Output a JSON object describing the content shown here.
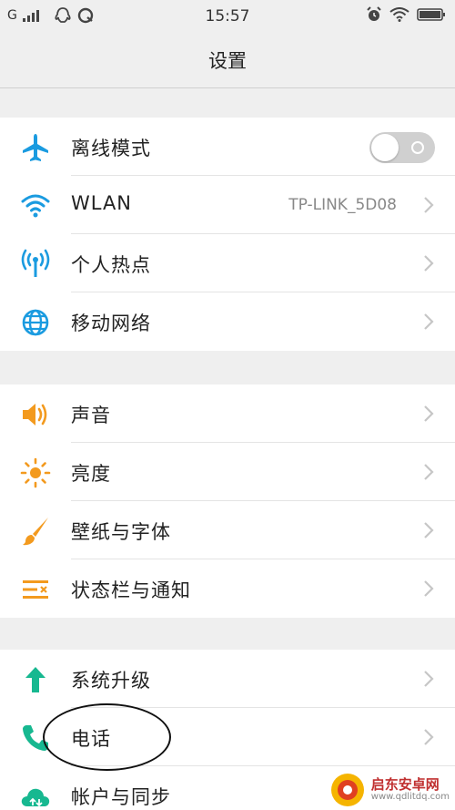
{
  "status_bar": {
    "carrier": "G",
    "time": "15:57"
  },
  "header": {
    "title": "设置"
  },
  "groups": [
    {
      "items": [
        {
          "label": "离线模式",
          "icon": "airplane-icon",
          "toggle_on": false
        },
        {
          "label": "WLAN",
          "icon": "wifi-icon",
          "value": "TP-LINK_5D08"
        },
        {
          "label": "个人热点",
          "icon": "hotspot-icon"
        },
        {
          "label": "移动网络",
          "icon": "globe-icon"
        }
      ]
    },
    {
      "items": [
        {
          "label": "声音",
          "icon": "speaker-icon"
        },
        {
          "label": "亮度",
          "icon": "sun-icon"
        },
        {
          "label": "壁纸与字体",
          "icon": "brush-icon"
        },
        {
          "label": "状态栏与通知",
          "icon": "statusbar-icon"
        }
      ]
    },
    {
      "items": [
        {
          "label": "系统升级",
          "icon": "upgrade-arrow-icon"
        },
        {
          "label": "电话",
          "icon": "phone-icon"
        },
        {
          "label": "帐户与同步",
          "icon": "cloud-sync-icon"
        }
      ]
    }
  ],
  "colors": {
    "blue": "#1a9be0",
    "orange": "#f39a1e",
    "teal": "#17b890",
    "chevron": "#c6c6c6"
  },
  "watermark": {
    "name": "启东安卓网",
    "url": "www.qdlitdq.com"
  }
}
